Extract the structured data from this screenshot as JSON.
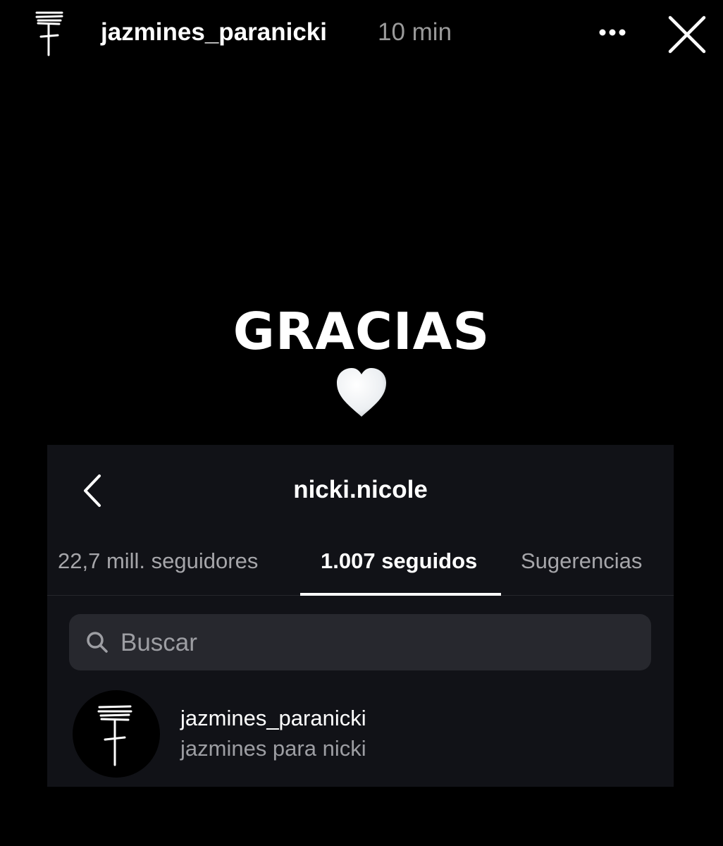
{
  "story": {
    "username": "jazmines_paranicki",
    "time": "10 min",
    "avatar_icon": "scribbled-t-logo-icon",
    "more_icon": "more-dots-icon",
    "close_icon": "close-icon"
  },
  "content": {
    "headline": "GRACIAS",
    "emoji": "white-heart-icon"
  },
  "embedded_screen": {
    "profile_name": "nicki.nicole",
    "back_icon": "chevron-left-icon",
    "tabs": [
      {
        "label": "22,7 mill. seguidores",
        "active": false
      },
      {
        "label": "1.007 seguidos",
        "active": true
      },
      {
        "label": "Sugerencias",
        "active": false
      }
    ],
    "search": {
      "placeholder": "Buscar",
      "icon": "search-icon"
    },
    "results": [
      {
        "username": "jazmines_paranicki",
        "full_name": "jazmines para nicki",
        "avatar_icon": "scribbled-t-logo-icon"
      }
    ]
  },
  "colors": {
    "background": "#000000",
    "card": "#111217",
    "search_box": "#27282e",
    "muted_text": "#9d9ea3"
  }
}
